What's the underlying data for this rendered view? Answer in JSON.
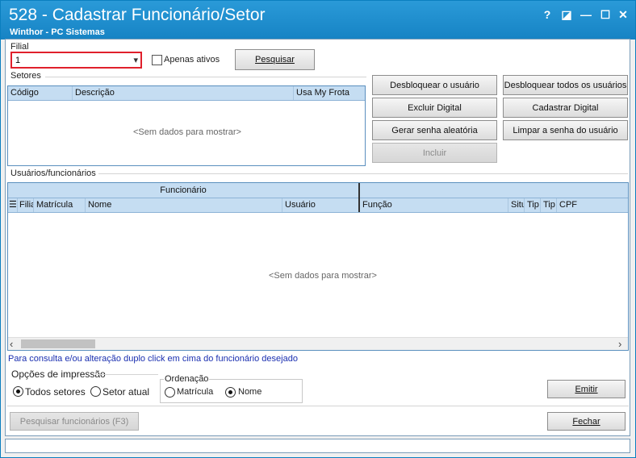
{
  "window": {
    "title": "528 - Cadastrar Funcionário/Setor",
    "subtitle": "Winthor - PC Sistemas",
    "help_label": "?",
    "restore_label": "◪",
    "minimize_label": "—",
    "maximize_label": "☐",
    "close_label": "✕"
  },
  "filter": {
    "filial_label": "Filial",
    "filial_value": "1",
    "apenas_ativos_label": "Apenas ativos",
    "pesquisar_label": "Pesquisar"
  },
  "setores": {
    "group_label": "Setores",
    "columns": [
      "Código",
      "Descrição",
      "Usa My Frota"
    ],
    "empty_text": "<Sem dados para mostrar>"
  },
  "actions": {
    "desbloquear_usuario": "Desbloquear o usuário",
    "desbloquear_todos": "Desbloquear todos os usuários",
    "excluir_digital": "Excluir Digital",
    "cadastrar_digital": "Cadastrar Digital",
    "gerar_senha": "Gerar senha aleatória",
    "limpar_senha": "Limpar a senha do usuário",
    "incluir": "Incluir"
  },
  "usuarios": {
    "group_label": "Usuários/funcionários",
    "band_funcionario": "Funcionário",
    "columns_left": [
      "Filia",
      "Matrícula",
      "Nome",
      "Usuário"
    ],
    "columns_right": [
      "Função",
      "Situ",
      "Tip",
      "Tip",
      "CPF"
    ],
    "empty_text": "<Sem dados para mostrar>",
    "scroll_left": "‹",
    "scroll_right": "›"
  },
  "hint_text": "Para consulta e/ou alteração duplo click em cima do funcionário desejado",
  "impressao": {
    "group_label": "Opções de impressão",
    "todos_setores": "Todos setores",
    "setor_atual": "Setor atual",
    "selected": "Todos setores"
  },
  "ordenacao": {
    "group_label": "Ordenação",
    "matricula": "Matrícula",
    "nome": "Nome",
    "selected": "Nome"
  },
  "buttons": {
    "emitir": "Emitir",
    "pesquisar_funcionarios": "Pesquisar funcionários (F3)",
    "fechar": "Fechar"
  }
}
